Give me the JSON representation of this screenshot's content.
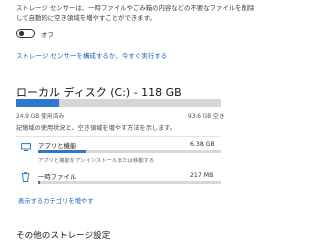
{
  "storage_sense": {
    "description_line1": "ストレージ センサーは、一時ファイルやごみ箱の内容などの不要なファイルを削除",
    "description_line2": "して自動的に空き領域を増やすことができます。",
    "toggle_label": "オフ",
    "toggle_on": false,
    "configure_link": "ストレージ センサーを構成するか、今すぐ実行する"
  },
  "local_disk": {
    "heading": "ローカル ディスク (C:) - 118 GB",
    "used_fraction": 0.21,
    "used_label": "24.9 GB 使用済み",
    "free_label": "93.6 GB 空き",
    "info_text": "記憶域の使用状況と、空き領域を増やす方法を示します。",
    "categories": [
      {
        "label": "アプリと機能",
        "size": "6.38 GB",
        "fraction": 0.26,
        "description": "アプリと機能をアンインストールまたは移動する"
      },
      {
        "label": "一時ファイル",
        "size": "217 MB",
        "fraction": 0.01
      }
    ],
    "show_more_link": "表示するカテゴリを増やす"
  },
  "other_storage": {
    "heading": "その他のストレージ設定"
  },
  "colors": {
    "accent": "#2c78cf",
    "link": "#1a62c0",
    "track": "#d6d6d6"
  }
}
